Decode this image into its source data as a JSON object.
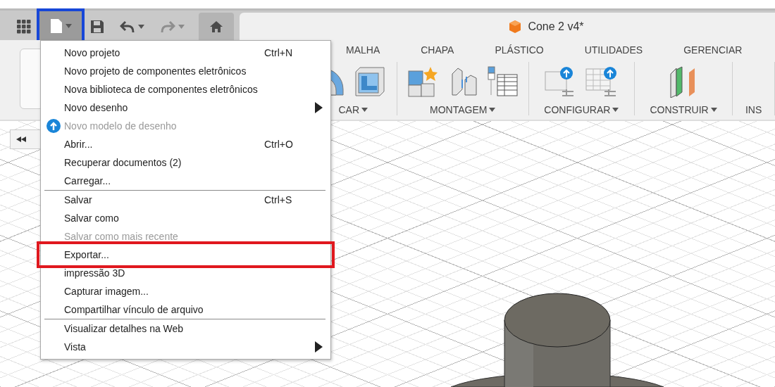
{
  "toolbar": {
    "buttons": [
      {
        "kind": "apps",
        "highlighted": false,
        "disabled": false
      },
      {
        "kind": "file",
        "highlighted": true,
        "disabled": false
      },
      {
        "kind": "save",
        "highlighted": false,
        "disabled": false
      },
      {
        "kind": "undo",
        "highlighted": false,
        "disabled": false
      },
      {
        "kind": "redo",
        "highlighted": false,
        "disabled": true
      },
      {
        "kind": "home",
        "highlighted": false,
        "disabled": false
      }
    ]
  },
  "document_tab": {
    "title": "Cone 2 v4*"
  },
  "ribbon": {
    "tabs": [
      {
        "label": "MALHA",
        "selected": false
      },
      {
        "label": "CHAPA",
        "selected": false
      },
      {
        "label": "PLÁSTICO",
        "selected": false
      },
      {
        "label": "UTILIDADES",
        "selected": false
      },
      {
        "label": "GERENCIAR",
        "selected": false
      }
    ],
    "groups": [
      {
        "label": "CAR",
        "dropdown": true,
        "tools": [
          {
            "kind": "revolve"
          },
          {
            "kind": "shell"
          }
        ]
      },
      {
        "label": "MONTAGEM",
        "dropdown": true,
        "tools": [
          {
            "kind": "new-component"
          },
          {
            "kind": "joint"
          },
          {
            "kind": "table"
          }
        ]
      },
      {
        "label": "CONFIGURAR",
        "dropdown": true,
        "tools": [
          {
            "kind": "config-box"
          },
          {
            "kind": "config-table"
          }
        ]
      },
      {
        "label": "CONSTRUIR",
        "dropdown": true,
        "tools": [
          {
            "kind": "planes"
          }
        ]
      },
      {
        "label": "INS",
        "dropdown": false
      }
    ]
  },
  "menu": {
    "groups": [
      [
        {
          "label": "Novo projeto",
          "shortcut": "Ctrl+N",
          "submenu": false,
          "disabled": false,
          "highlighted": false,
          "badge": false
        },
        {
          "label": "Novo projeto de componentes eletrônicos",
          "submenu": false,
          "disabled": false,
          "highlighted": false,
          "badge": false
        },
        {
          "label": "Nova biblioteca de componentes eletrônicos",
          "submenu": false,
          "disabled": false,
          "highlighted": false,
          "badge": false
        },
        {
          "label": "Novo desenho",
          "submenu": true,
          "disabled": false,
          "highlighted": false,
          "badge": false
        },
        {
          "label": "Novo modelo de desenho",
          "submenu": false,
          "disabled": true,
          "highlighted": false,
          "badge": true
        },
        {
          "label": "Abrir...",
          "shortcut": "Ctrl+O",
          "submenu": false,
          "disabled": false,
          "highlighted": false,
          "badge": false
        },
        {
          "label": "Recuperar documentos (2)",
          "submenu": false,
          "disabled": false,
          "highlighted": false,
          "badge": false
        },
        {
          "label": "Carregar...",
          "submenu": false,
          "disabled": false,
          "highlighted": false,
          "badge": false
        }
      ],
      [
        {
          "label": "Salvar",
          "shortcut": "Ctrl+S",
          "submenu": false,
          "disabled": false,
          "highlighted": false,
          "badge": false
        },
        {
          "label": "Salvar como",
          "submenu": false,
          "disabled": false,
          "highlighted": false,
          "badge": false
        },
        {
          "label": "Salvar como mais recente",
          "submenu": false,
          "disabled": true,
          "highlighted": false,
          "badge": false
        },
        {
          "label": "Exportar...",
          "submenu": false,
          "disabled": false,
          "highlighted": true,
          "badge": false
        },
        {
          "label": "impressão 3D",
          "submenu": false,
          "disabled": false,
          "highlighted": false,
          "badge": false
        },
        {
          "label": "Capturar imagem...",
          "submenu": false,
          "disabled": false,
          "highlighted": false,
          "badge": false
        },
        {
          "label": "Compartilhar vínculo de arquivo",
          "submenu": false,
          "disabled": false,
          "highlighted": false,
          "badge": false
        }
      ],
      [
        {
          "label": "Visualizar detalhes na Web",
          "submenu": false,
          "disabled": false,
          "highlighted": false,
          "badge": false
        },
        {
          "label": "Vista",
          "submenu": true,
          "disabled": false,
          "highlighted": false,
          "badge": false
        }
      ]
    ]
  }
}
